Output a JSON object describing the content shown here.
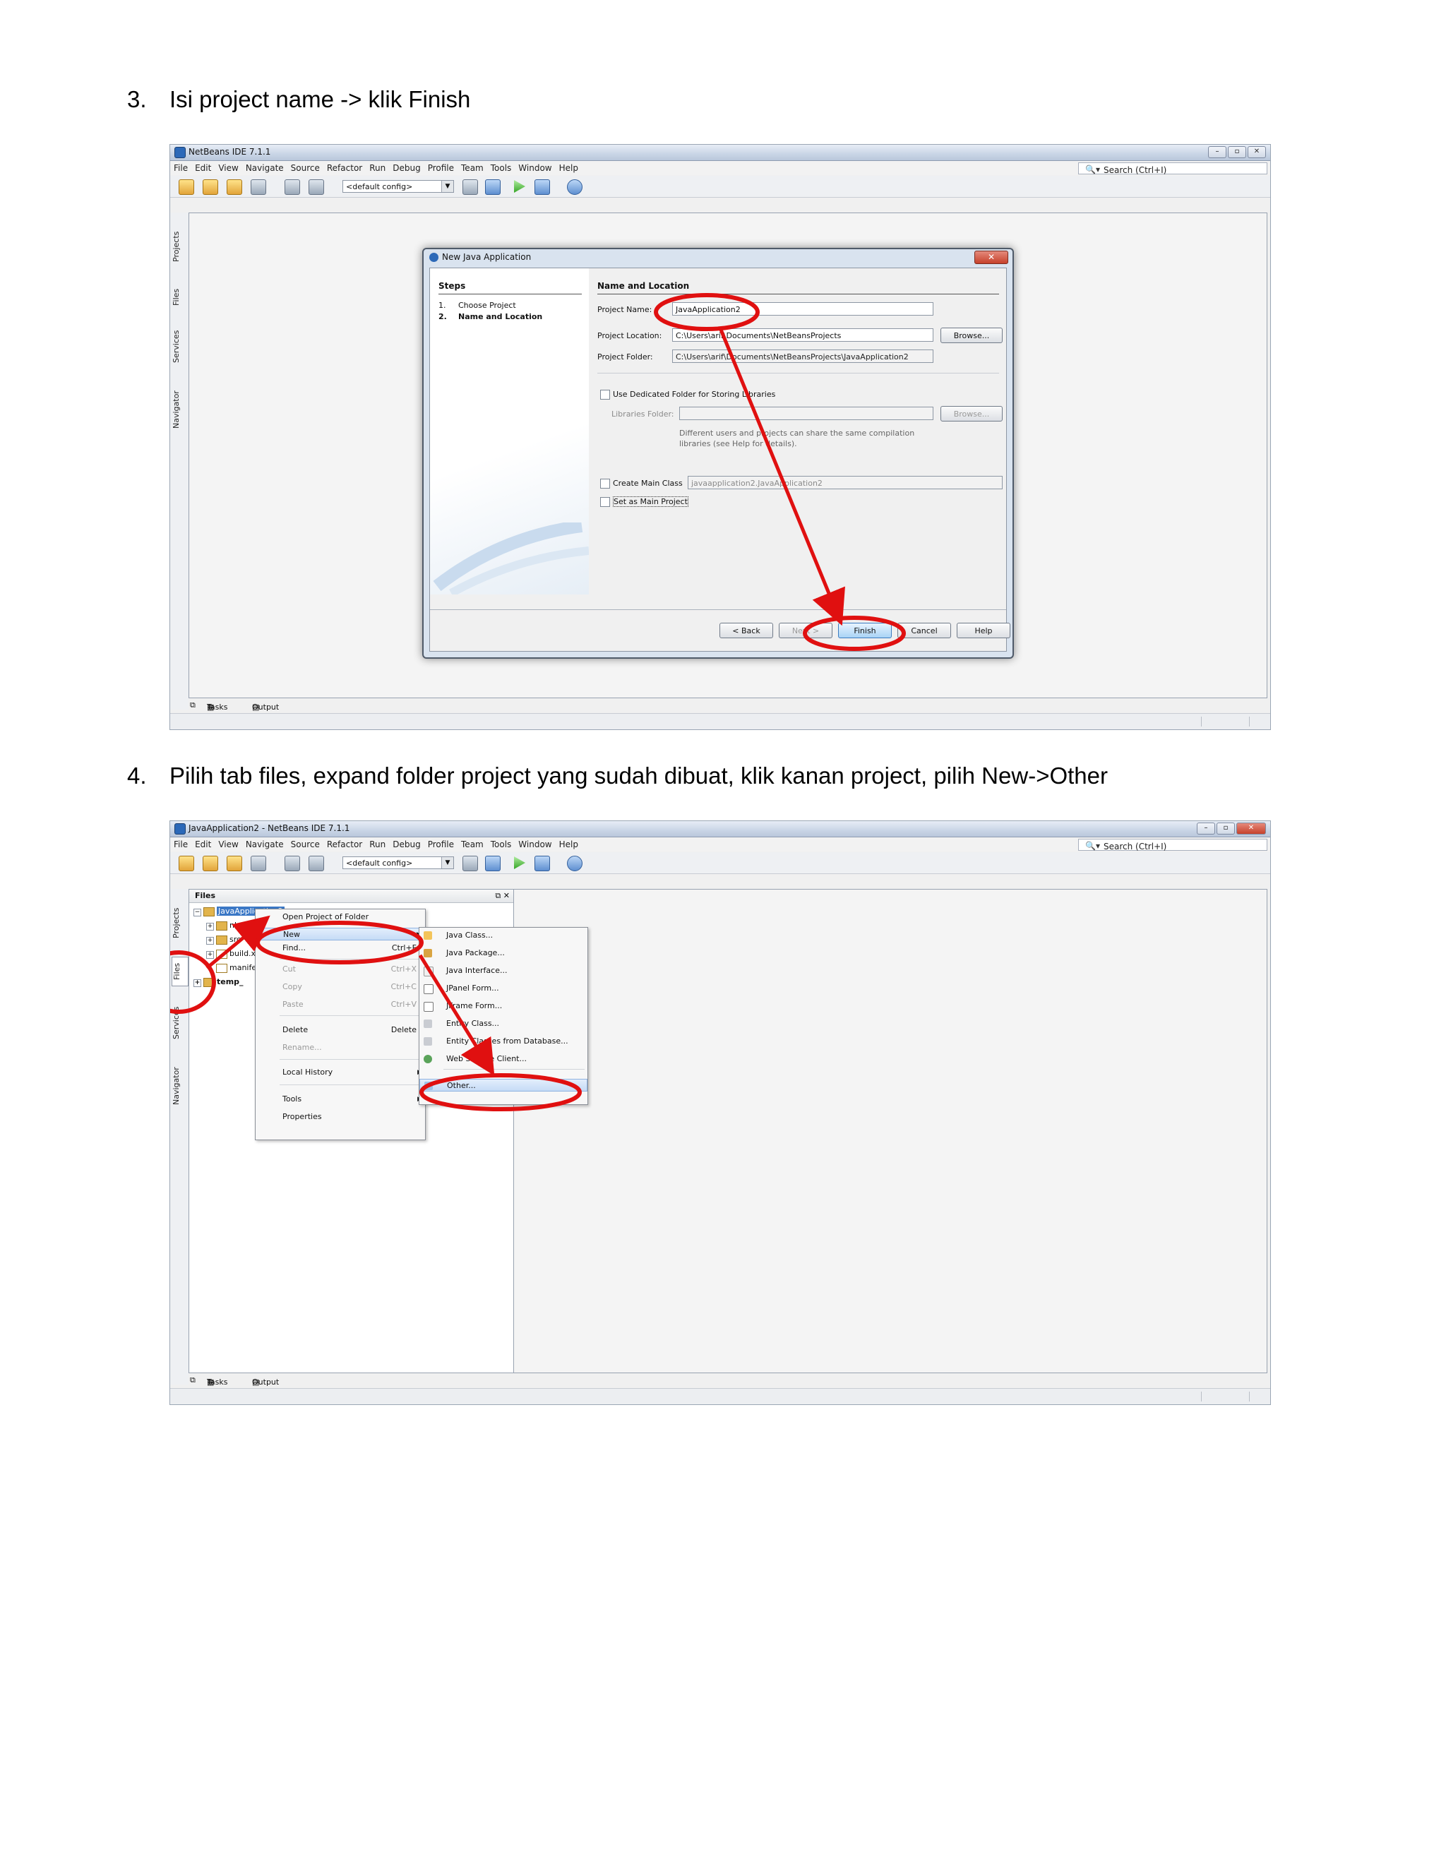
{
  "step3": {
    "number": "3.",
    "text": "Isi project name -> klik Finish"
  },
  "step4": {
    "number": "4.",
    "text": "Pilih tab files, expand folder project yang sudah dibuat, klik kanan project, pilih New->Other"
  },
  "ide": {
    "menu": [
      "File",
      "Edit",
      "View",
      "Navigate",
      "Source",
      "Refactor",
      "Run",
      "Debug",
      "Profile",
      "Team",
      "Tools",
      "Window",
      "Help"
    ],
    "search_placeholder": "Search (Ctrl+I)",
    "config": "<default config>",
    "side_tabs": [
      "Projects",
      "Files",
      "Services",
      "Navigator"
    ],
    "bottom_tabs": [
      "Tasks",
      "Output"
    ]
  },
  "shot1": {
    "title": "NetBeans IDE 7.1.1",
    "dialog": {
      "title": "New Java Application",
      "steps_header": "Steps",
      "steps": [
        {
          "n": "1.",
          "label": "Choose Project"
        },
        {
          "n": "2.",
          "label": "Name and Location"
        }
      ],
      "section": "Name and Location",
      "project_name_label": "Project Name:",
      "project_name": "JavaApplication2",
      "location_label": "Project Location:",
      "location": "C:\\Users\\arif\\Documents\\NetBeansProjects",
      "folder_label": "Project Folder:",
      "folder": "C:\\Users\\arif\\Documents\\NetBeansProjects\\JavaApplication2",
      "browse": "Browse...",
      "dedicated": "Use Dedicated Folder for Storing Libraries",
      "libraries_label": "Libraries Folder:",
      "note": "Different users and projects can share the same compilation libraries (see Help for details).",
      "create_main": "Create Main Class",
      "main_class": "javaapplication2.JavaApplication2",
      "set_main": "Set as Main Project",
      "back": "< Back",
      "next": "Next >",
      "finish": "Finish",
      "cancel": "Cancel",
      "help": "Help"
    }
  },
  "shot2": {
    "title": "JavaApplication2 - NetBeans IDE 7.1.1",
    "panel_title": "Files",
    "tree": [
      "JavaApplication2",
      "nbproject",
      "src",
      "build.xml",
      "manifest.mf",
      "temp_"
    ],
    "context_menu": [
      {
        "label": "Open Project of Folder",
        "shortcut": ""
      },
      {
        "label": "New",
        "shortcut": ""
      },
      {
        "label": "Find...",
        "shortcut": "Ctrl+F"
      },
      {
        "label": "Cut",
        "shortcut": "Ctrl+X"
      },
      {
        "label": "Copy",
        "shortcut": "Ctrl+C"
      },
      {
        "label": "Paste",
        "shortcut": "Ctrl+V"
      },
      {
        "label": "Delete",
        "shortcut": "Delete"
      },
      {
        "label": "Rename...",
        "shortcut": ""
      },
      {
        "label": "Local History",
        "shortcut": ""
      },
      {
        "label": "Tools",
        "shortcut": ""
      },
      {
        "label": "Properties",
        "shortcut": ""
      }
    ],
    "submenu": [
      "Java Class...",
      "Java Package...",
      "Java Interface...",
      "JPanel Form...",
      "JFrame Form...",
      "Entity Class...",
      "Entity Classes from Database...",
      "Web Service Client...",
      "Other..."
    ]
  },
  "colors": {
    "annotation": "#e01010",
    "selection": "#3b78c6"
  }
}
